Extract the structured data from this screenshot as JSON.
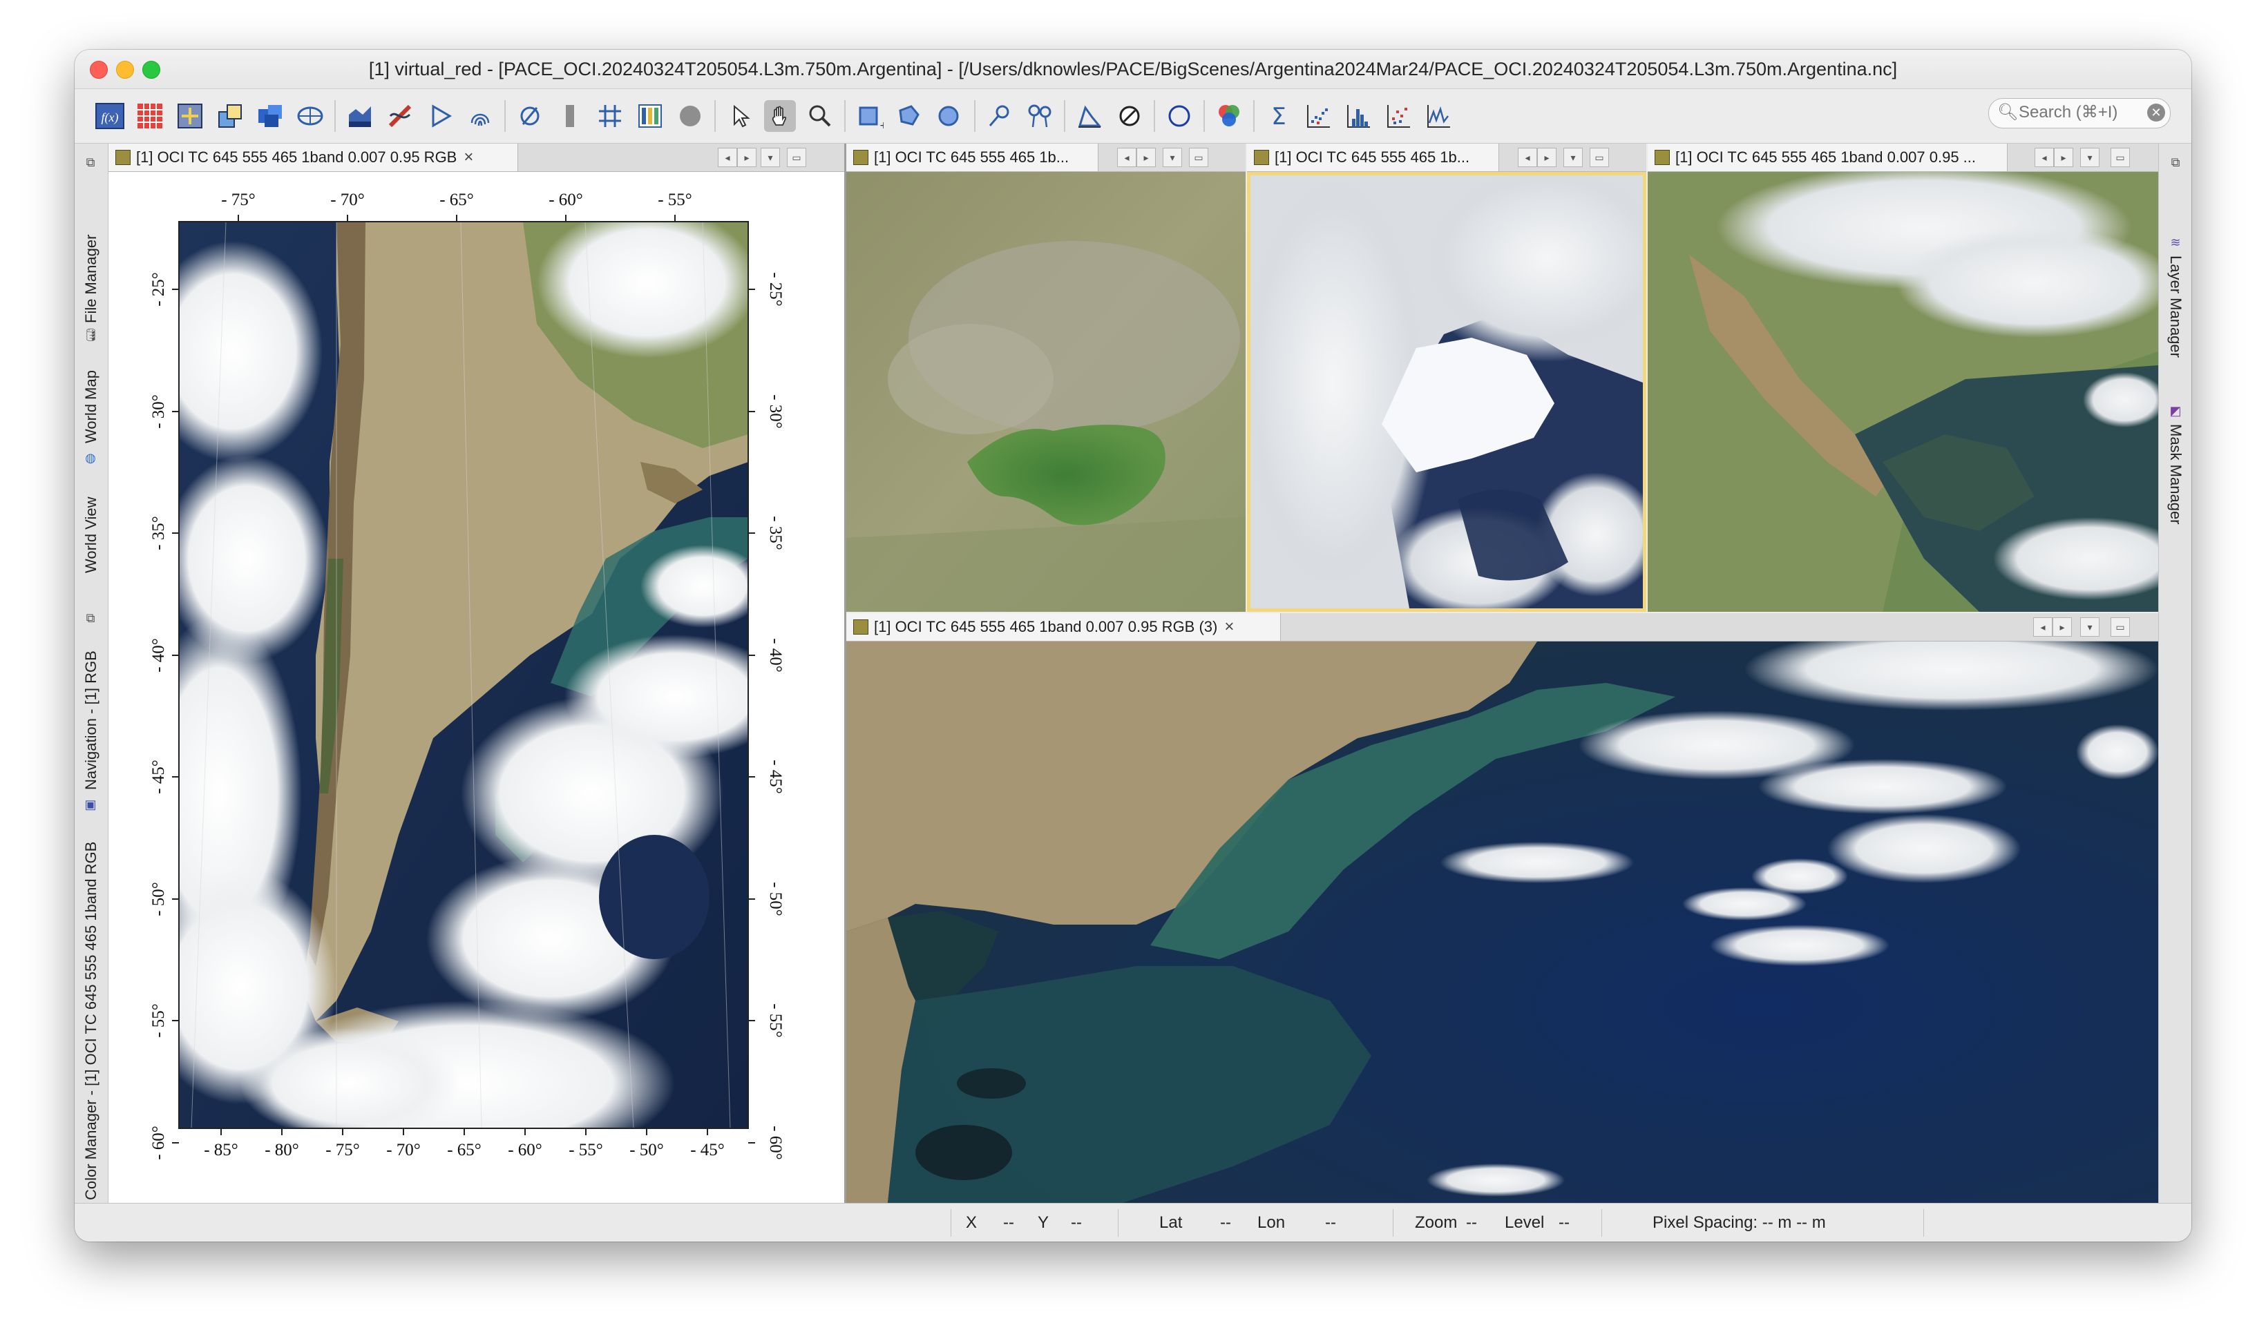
{
  "window": {
    "title": "[1] virtual_red - [PACE_OCI.20240324T205054.L3m.750m.Argentina] - [/Users/dknowles/PACE/BigScenes/Argentina2024Mar24/PACE_OCI.20240324T205054.L3m.750m.Argentina.nc]"
  },
  "toolbar": {
    "icons": [
      "band-maths-icon",
      "pixel-grid-icon",
      "resample-icon",
      "reproject-icon",
      "mosaic-icon",
      "globe-icon",
      "import-icon",
      "spectrum-icon",
      "play-icon",
      "fingerprint-icon",
      "no-data-icon",
      "color-bar-icon",
      "graticule-icon",
      "layer-editor-icon",
      "gray-sphere-icon",
      "select-tool-icon",
      "pan-tool-icon",
      "zoom-tool-icon",
      "rectangle-draw-icon",
      "polygon-draw-icon",
      "ellipse-draw-icon",
      "pin-tool-icon",
      "range-finder-icon",
      "mask-tool-icon",
      "magic-wand-icon",
      "circle-tool-icon",
      "rgb-icon",
      "sum-icon",
      "scatter-plot-icon",
      "histogram-icon",
      "density-plot-icon",
      "profile-plot-icon"
    ],
    "search_placeholder": "Search (⌘+I)",
    "search_symbol": "🔍︎",
    "clear_symbol": "✕"
  },
  "left_strip": {
    "tabs": [
      "File Manager",
      "World Map",
      "World View",
      "Navigation - [1] RGB",
      "Color Manager - [1] OCI TC 645 555 465 1band RGB"
    ]
  },
  "right_strip": {
    "tabs": [
      "Layer Manager",
      "Mask Manager"
    ]
  },
  "views": {
    "main": {
      "tab_label": "[1] OCI TC 645 555 465 1band 0.007 0.95 RGB"
    },
    "small1": {
      "tab_label": "[1] OCI TC 645 555 465 1b..."
    },
    "small2": {
      "tab_label": "[1] OCI TC 645 555 465 1b..."
    },
    "small3": {
      "tab_label": "[1] OCI TC 645 555 465 1band 0.007 0.95 ..."
    },
    "bottom": {
      "tab_label": "[1] OCI TC 645 555 465 1band 0.007 0.95 RGB (3)"
    },
    "close_symbol": "×",
    "nav_left": "◂",
    "nav_right": "▸",
    "nav_down": "▾",
    "maximize": "▭"
  },
  "graticule": {
    "top_lon": [
      "- 75°",
      "- 70°",
      "- 65°",
      "- 60°",
      "- 55°"
    ],
    "bottom_lon": [
      "- 85°",
      "- 80°",
      "- 75°",
      "- 70°",
      "- 65°",
      "- 60°",
      "- 55°",
      "- 50°",
      "- 45°"
    ],
    "lat": [
      "- 25°",
      "- 30°",
      "- 35°",
      "- 40°",
      "- 45°",
      "- 50°",
      "- 55°",
      "- 60°"
    ]
  },
  "statusbar": {
    "x_label": "X",
    "x_value": "--",
    "y_label": "Y",
    "y_value": "--",
    "lat_label": "Lat",
    "lat_value": "--",
    "lon_label": "Lon",
    "lon_value": "--",
    "zoom_label": "Zoom",
    "zoom_value": "--",
    "level_label": "Level",
    "level_value": "--",
    "pixel_spacing": "Pixel Spacing: -- m -- m"
  },
  "colors": {
    "ocean_dark": "#16284a",
    "ocean_teal": "#2f6e6b",
    "land_tan": "#b0a07c",
    "cloud": "#f1f2f3",
    "selected_view_border": "#f3d77a"
  }
}
